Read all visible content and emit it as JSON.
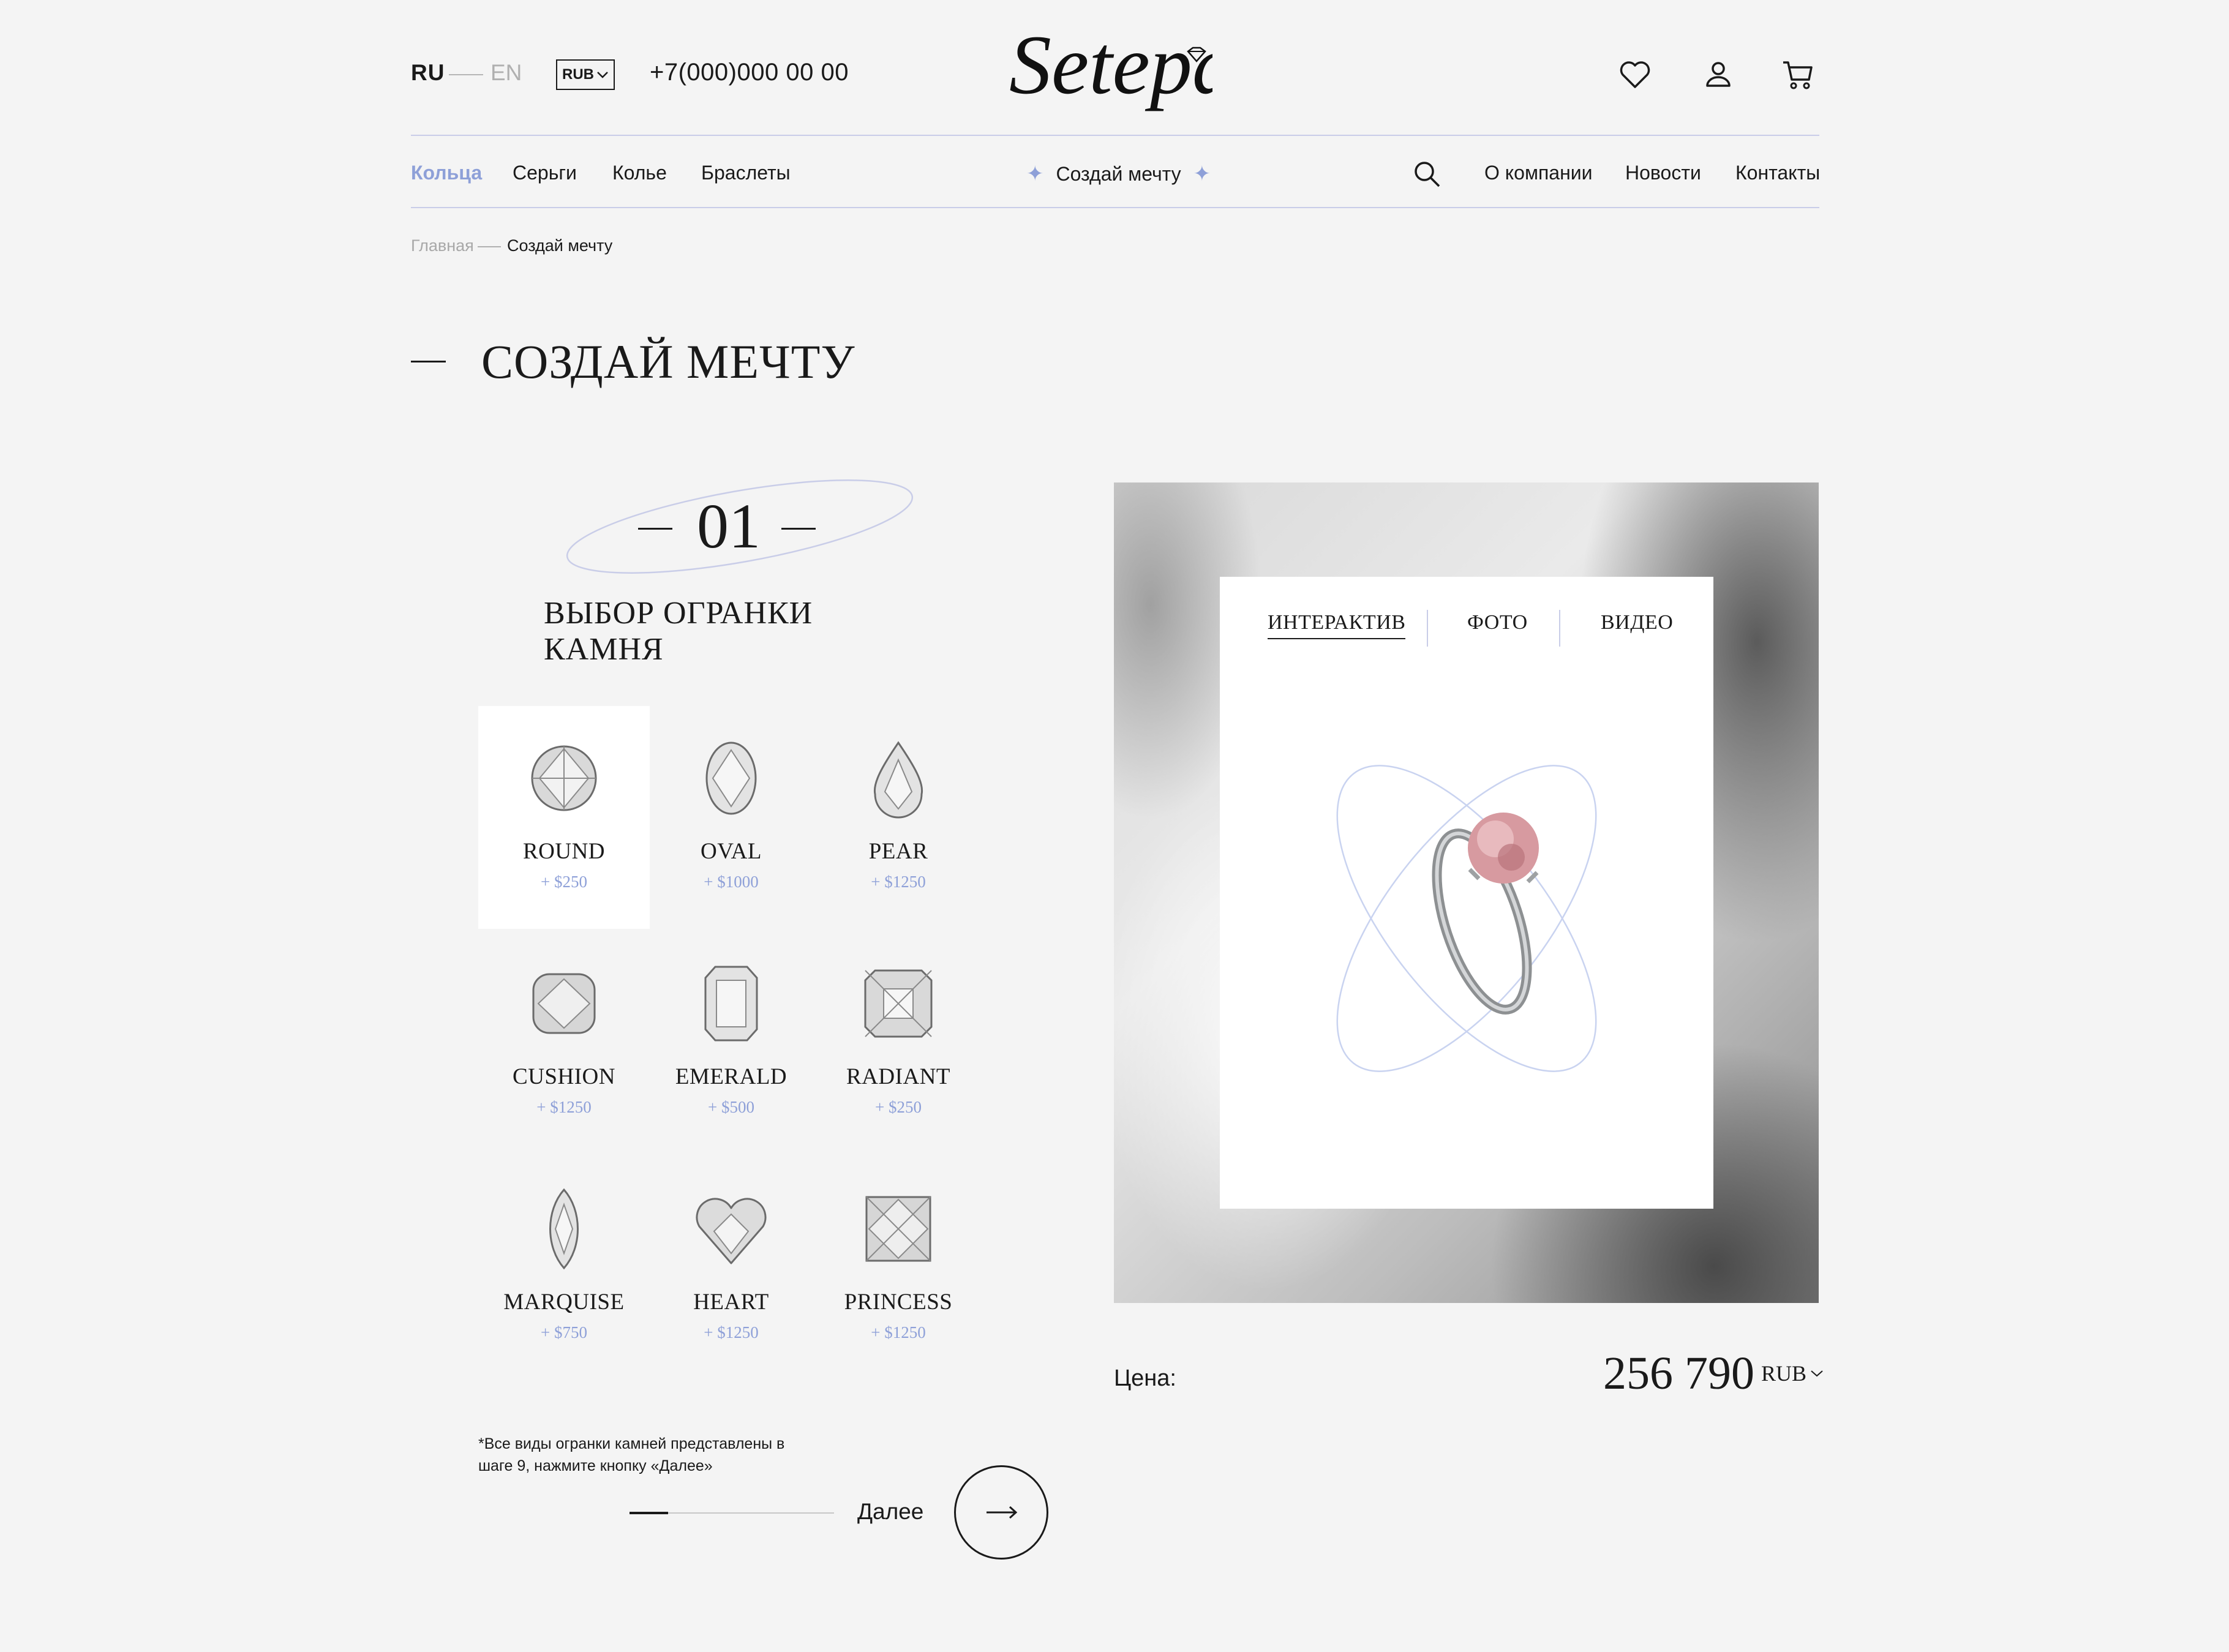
{
  "header": {
    "lang_active": "RU",
    "lang_other": "EN",
    "currency": "RUB",
    "phone": "+7(000)000 00 00",
    "logo_text": "Setepai"
  },
  "nav": {
    "left": [
      "Кольца",
      "Серьги",
      "Колье",
      "Браслеты"
    ],
    "center": "Создай мечту",
    "right": [
      "О компании",
      "Новости",
      "Контакты"
    ]
  },
  "breadcrumb": {
    "home": "Главная",
    "current": "Создай мечту"
  },
  "page_title": "СОЗДАЙ МЕЧТУ",
  "step": {
    "number": "01",
    "title": "ВЫБОР ОГРАНКИ КАМНЯ",
    "progress_fraction": 0.19
  },
  "cuts": [
    {
      "name": "ROUND",
      "price": "+ $250",
      "selected": true
    },
    {
      "name": "OVAL",
      "price": "+ $1000"
    },
    {
      "name": "PEAR",
      "price": "+ $1250"
    },
    {
      "name": "CUSHION",
      "price": "+ $1250"
    },
    {
      "name": "EMERALD",
      "price": "+ $500"
    },
    {
      "name": "RADIANT",
      "price": "+ $250"
    },
    {
      "name": "MARQUISE",
      "price": "+ $750"
    },
    {
      "name": "HEART",
      "price": "+ $1250"
    },
    {
      "name": "PRINCESS",
      "price": "+ $1250"
    }
  ],
  "note": "*Все виды огранки камней представлены в шаге 9, нажмите кнопку «Далее»",
  "next_label": "Далее",
  "viewer": {
    "tabs": [
      "ИНТЕРАКТИВ",
      "ФОТО",
      "ВИДЕО"
    ],
    "active_tab": "ИНТЕРАКТИВ"
  },
  "price": {
    "label": "Цена:",
    "value": "256 790",
    "currency": "RUB"
  },
  "colors": {
    "accent": "#8ea0d8",
    "background": "#f4f4f4",
    "text": "#1a1a1a"
  }
}
